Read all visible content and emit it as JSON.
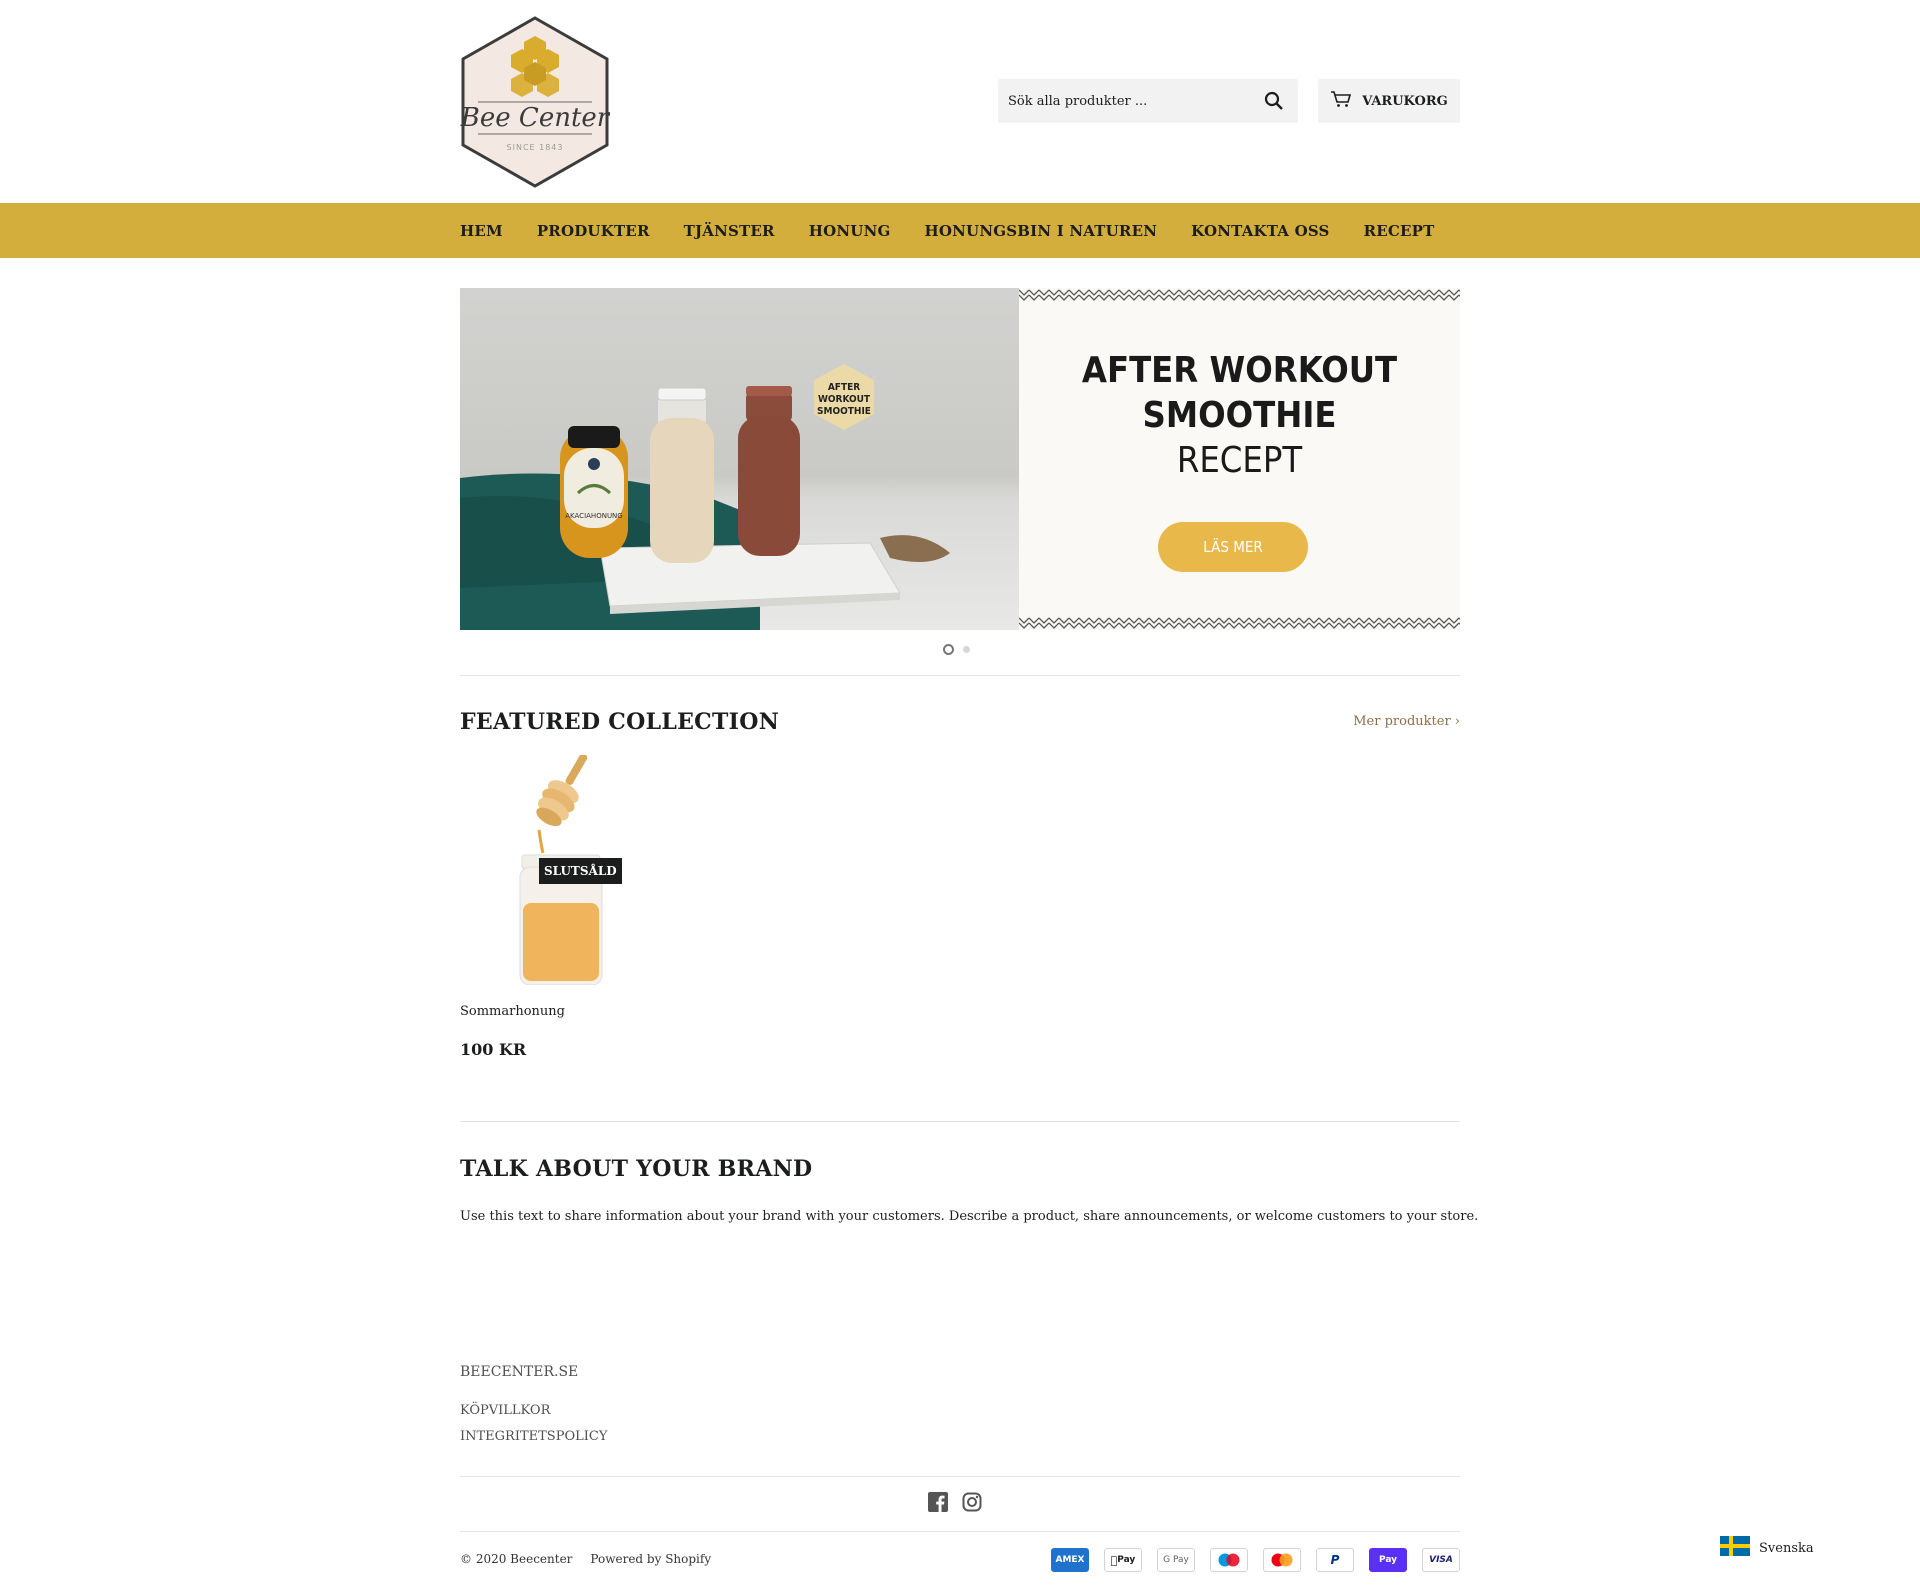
{
  "header": {
    "logo_text": "Bee Center",
    "logo_since": "SINCE 1843",
    "search_placeholder": "Sök alla produkter ...",
    "cart_label": "VARUKORG"
  },
  "nav": {
    "items": [
      "HEM",
      "PRODUKTER",
      "TJÄNSTER",
      "HONUNG",
      "HONUNGSBIN I NATUREN",
      "KONTAKTA OSS",
      "RECEPT"
    ]
  },
  "slideshow": {
    "badge_lines": [
      "AFTER",
      "WORKOUT",
      "SMOOTHIE"
    ],
    "jar_label": "AKACIAHONUNG",
    "title_line1": "AFTER WORKOUT",
    "title_line2": "SMOOTHIE",
    "title_line3": "RECEPT",
    "button_label": "LÄS MER",
    "dots": 2,
    "active_dot": 1
  },
  "featured": {
    "title": "FEATURED COLLECTION",
    "more_link": "Mer produkter ›",
    "product": {
      "name": "Sommarhonung",
      "price": "100 KR",
      "badge": "SLUTSÅLD"
    }
  },
  "brand": {
    "title": "TALK ABOUT YOUR BRAND",
    "text": "Use this text to share information about your brand with your customers. Describe a product, share announcements, or welcome customers to your store."
  },
  "footer": {
    "heading": "BEECENTER.SE",
    "links": [
      "KÖPVILLKOR",
      "INTEGRITETSPOLICY"
    ],
    "social": [
      "facebook-icon",
      "instagram-icon"
    ],
    "copyright": "© 2020 Beecenter",
    "powered": "Powered by Shopify",
    "payments": [
      "AMEX",
      "Pay",
      "G Pay",
      "",
      "",
      "P",
      "Pay",
      "VISA"
    ],
    "language": "Svenska"
  },
  "colors": {
    "nav_bg": "#d4ae3c",
    "button": "#e8b84b",
    "link": "#8a6f48"
  }
}
